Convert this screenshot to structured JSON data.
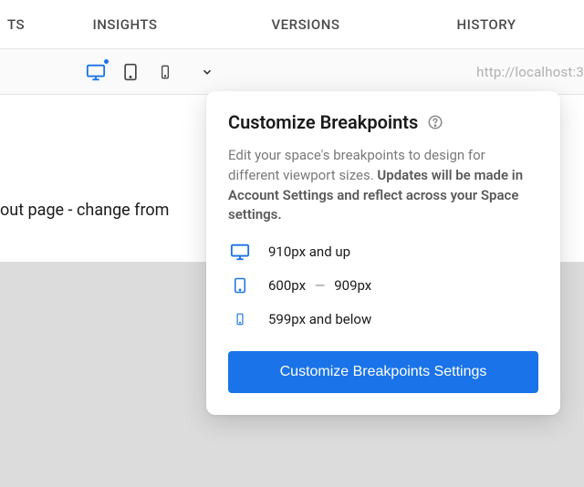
{
  "nav": {
    "tab_cut": "TS",
    "tabs": [
      "INSIGHTS",
      "VERSIONS",
      "HISTORY"
    ]
  },
  "url": "http://localhost:3",
  "page_title": "out page - change from",
  "devices": {
    "desktop": {
      "name": "desktop-icon",
      "active": true,
      "indicator": true
    },
    "tablet": {
      "name": "tablet-icon",
      "active": false
    },
    "mobile": {
      "name": "mobile-icon",
      "active": false
    }
  },
  "popover": {
    "title": "Customize Breakpoints",
    "desc_part1": "Edit your space's breakpoints to design for different viewport sizes. ",
    "desc_strong": "Updates will be made in Account Settings and reflect across your Space settings.",
    "breakpoints": [
      {
        "device": "desktop",
        "label": "910px and up"
      },
      {
        "device": "tablet",
        "min": "600px",
        "max": "909px"
      },
      {
        "device": "mobile",
        "label": "599px and below"
      }
    ],
    "cta": "Customize Breakpoints Settings"
  },
  "colors": {
    "accent": "#1a73e8"
  }
}
